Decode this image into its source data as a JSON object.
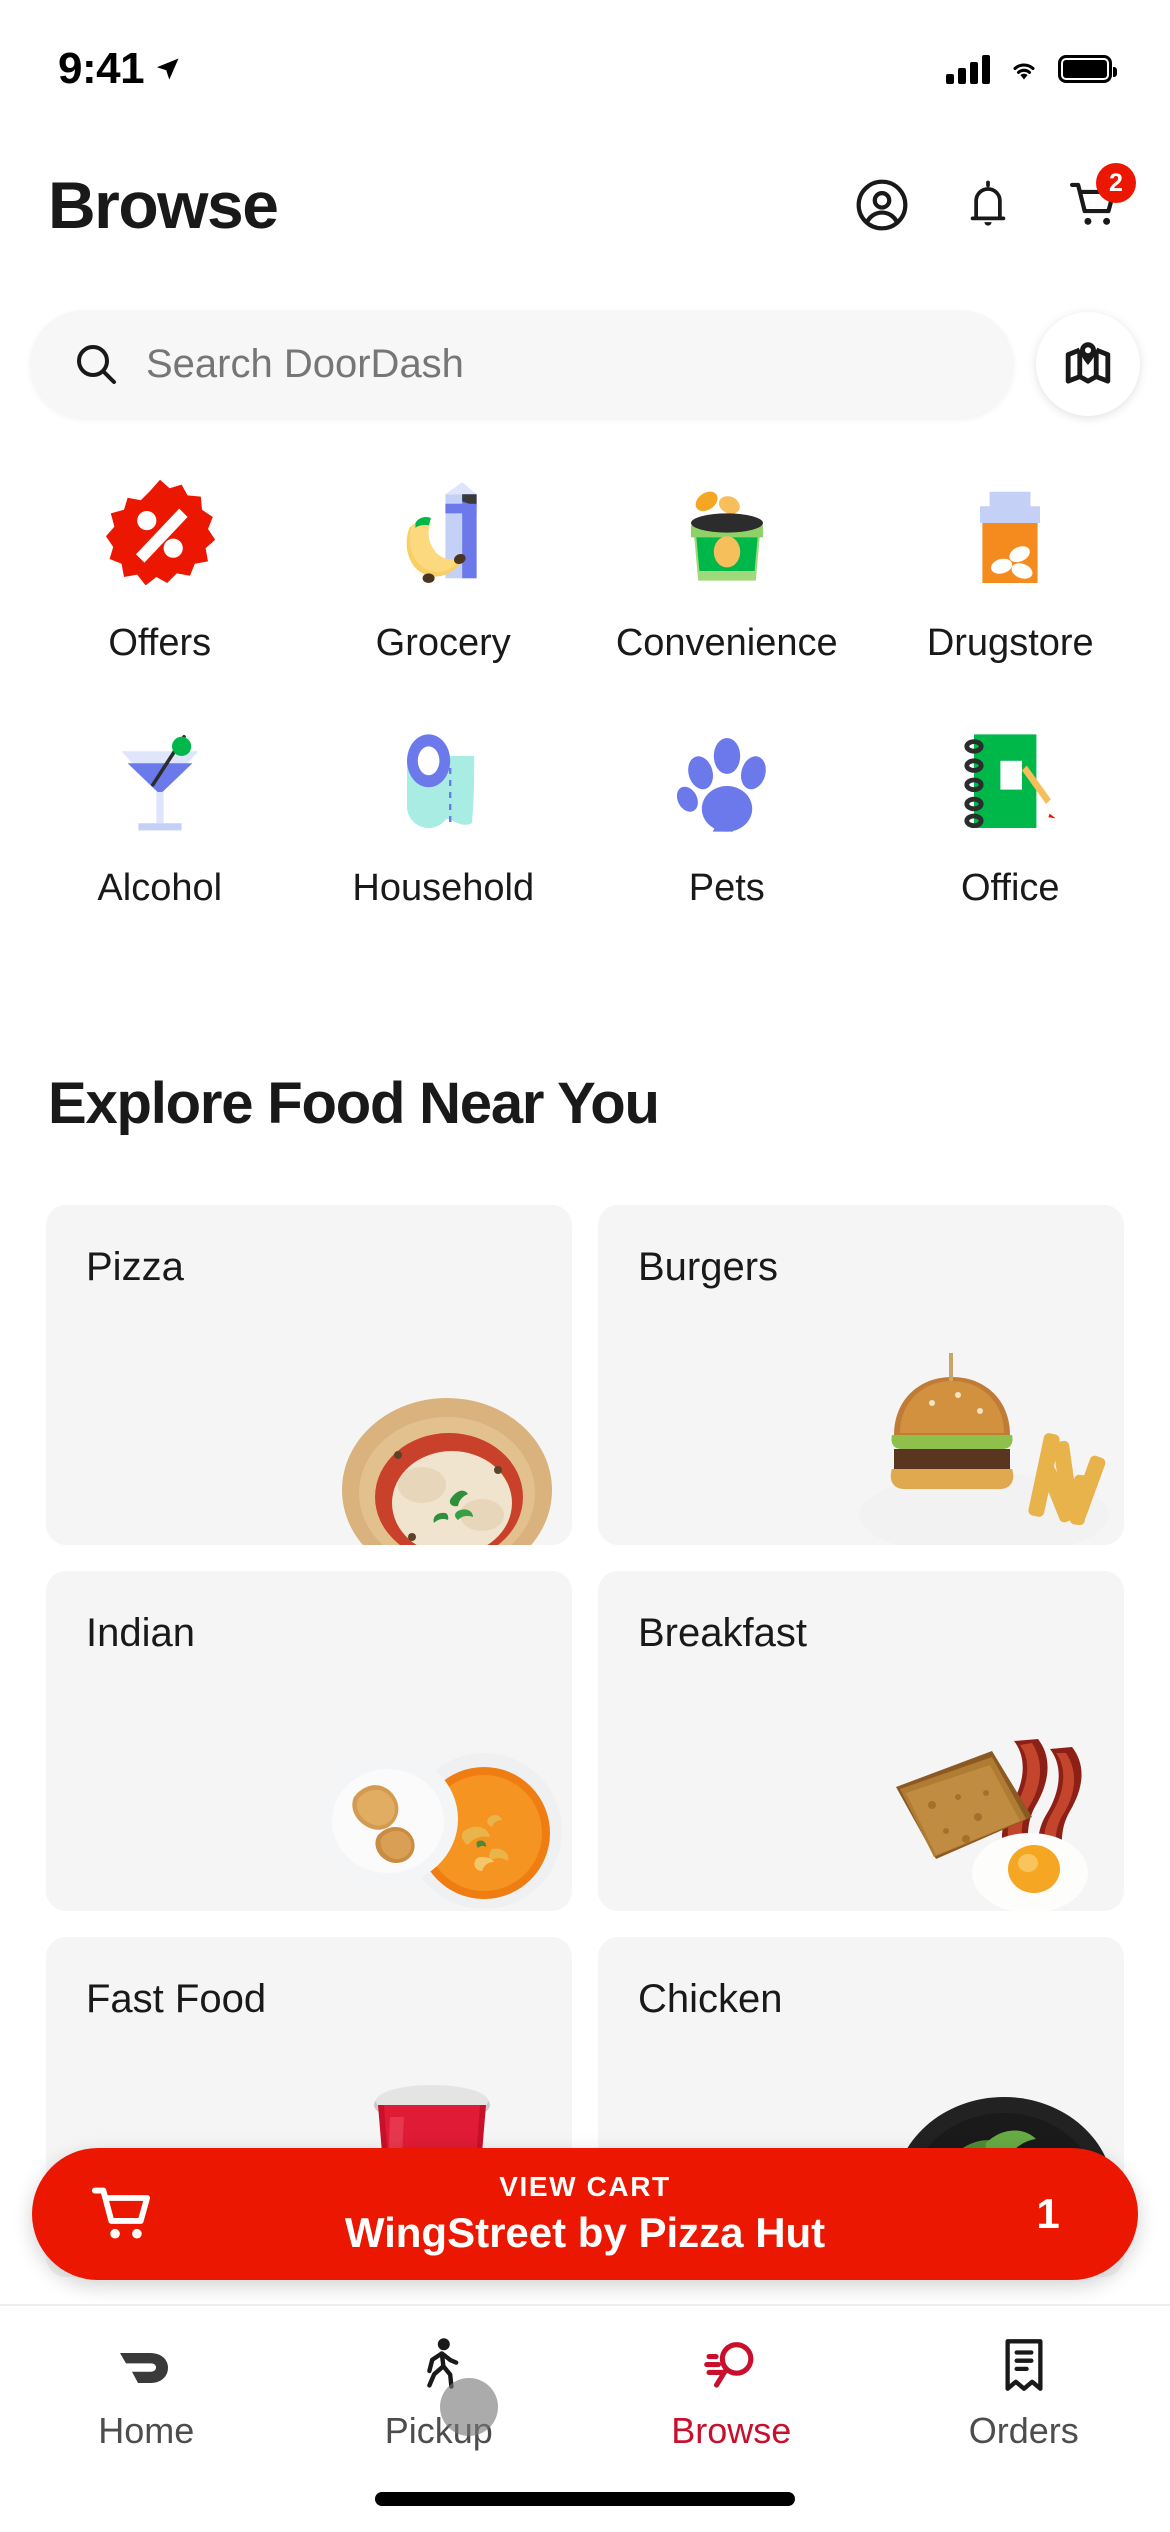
{
  "status_bar": {
    "time": "9:41",
    "location_icon": "location-arrow-icon",
    "signal_icon": "cellular-signal-icon",
    "wifi_icon": "wifi-icon",
    "battery_icon": "battery-full-icon"
  },
  "header": {
    "title": "Browse",
    "account_icon": "account-circle-icon",
    "notifications_icon": "bell-icon",
    "cart_icon": "shopping-cart-icon",
    "cart_badge": "2"
  },
  "search": {
    "placeholder": "Search DoorDash",
    "search_icon": "search-icon",
    "map_icon": "map-pin-icon"
  },
  "categories": [
    {
      "label": "Offers",
      "icon": "discount-badge-icon",
      "color": "#eb1700"
    },
    {
      "label": "Grocery",
      "icon": "banana-milk-carton-icon",
      "color": "#6b79ea"
    },
    {
      "label": "Convenience",
      "icon": "chip-bag-icon",
      "color": "#00b84a"
    },
    {
      "label": "Drugstore",
      "icon": "pill-bottle-icon",
      "color": "#f58a1f"
    },
    {
      "label": "Alcohol",
      "icon": "martini-glass-icon",
      "color": "#6b79ea"
    },
    {
      "label": "Household",
      "icon": "toilet-paper-icon",
      "color": "#a8ece4"
    },
    {
      "label": "Pets",
      "icon": "paw-print-icon",
      "color": "#6b79ea"
    },
    {
      "label": "Office",
      "icon": "notebook-pencil-icon",
      "color": "#00b84a"
    }
  ],
  "explore": {
    "title": "Explore Food Near You",
    "cards": [
      {
        "label": "Pizza",
        "art": "pizza-photo"
      },
      {
        "label": "Burgers",
        "art": "burger-fries-photo"
      },
      {
        "label": "Indian",
        "art": "samosa-curry-photo"
      },
      {
        "label": "Breakfast",
        "art": "toast-bacon-egg-photo"
      },
      {
        "label": "Fast Food",
        "art": "soda-cup-photo"
      },
      {
        "label": "Chicken",
        "art": "chicken-bowl-photo"
      }
    ]
  },
  "cart_banner": {
    "sub_label": "VIEW CART",
    "store_name": "WingStreet by Pizza Hut",
    "quantity": "1",
    "cart_icon": "shopping-cart-icon",
    "color": "#eb1700"
  },
  "tabs": [
    {
      "label": "Home",
      "icon": "doordash-logo-icon",
      "active": false
    },
    {
      "label": "Pickup",
      "icon": "walking-person-icon",
      "active": false
    },
    {
      "label": "Browse",
      "icon": "browse-search-icon",
      "active": true
    },
    {
      "label": "Orders",
      "icon": "receipt-icon",
      "active": false
    }
  ],
  "accent_colors": {
    "brand_red": "#eb1700",
    "active_tab": "#c8102e",
    "card_bg": "#f5f5f5",
    "search_bg": "#f7f7f7"
  }
}
